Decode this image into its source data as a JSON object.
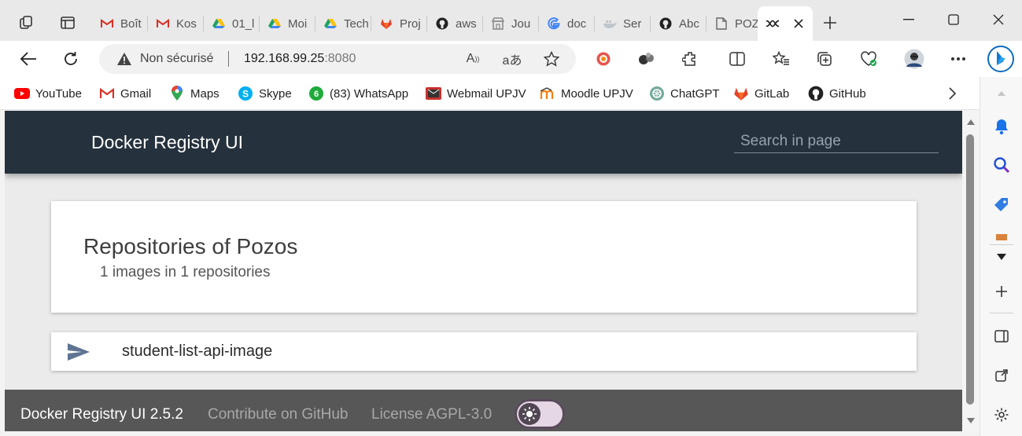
{
  "browser": {
    "tabs": [
      {
        "label": "Boît",
        "icon": "gmail-icon"
      },
      {
        "label": "Kos",
        "icon": "gmail-icon"
      },
      {
        "label": "01_l",
        "icon": "google-drive-icon"
      },
      {
        "label": "Moi",
        "icon": "google-drive-icon"
      },
      {
        "label": "Tech",
        "icon": "google-drive-icon"
      },
      {
        "label": "Proj",
        "icon": "gitlab-icon"
      },
      {
        "label": "aws",
        "icon": "github-icon"
      },
      {
        "label": "Jou",
        "icon": "store-icon"
      },
      {
        "label": "doc",
        "icon": "google-icon"
      },
      {
        "label": "Ser",
        "icon": "docker-icon"
      },
      {
        "label": "Abc",
        "icon": "github-icon"
      },
      {
        "label": "POZ",
        "icon": "page-icon"
      }
    ],
    "active_tab_icon": "docker-registry-icon",
    "address": {
      "security": "Non sécurisé",
      "host": "192.168.99.25",
      "port": ":8080"
    },
    "bookmarks": [
      {
        "label": "YouTube",
        "icon": "youtube-icon"
      },
      {
        "label": "Gmail",
        "icon": "gmail-icon"
      },
      {
        "label": "Maps",
        "icon": "maps-icon"
      },
      {
        "label": "Skype",
        "icon": "skype-icon"
      },
      {
        "label": "(83) WhatsApp",
        "icon": "whatsapp-icon"
      },
      {
        "label": "Webmail UPJV",
        "icon": "webmail-icon"
      },
      {
        "label": "Moodle UPJV",
        "icon": "moodle-icon"
      },
      {
        "label": "ChatGPT",
        "icon": "chatgpt-icon"
      },
      {
        "label": "GitLab",
        "icon": "gitlab-icon"
      },
      {
        "label": "GitHub",
        "icon": "github-icon"
      }
    ],
    "colors": {
      "tabstrip": "#e9e9e9",
      "accent": "#0f6cbd"
    }
  },
  "page": {
    "app_title": "Docker Registry UI",
    "search_placeholder": "Search in page",
    "header_card": {
      "title": "Repositories of Pozos",
      "subtitle": "1 images in 1 repositories"
    },
    "repositories": [
      {
        "name": "student-list-api-image",
        "icon": "send-icon"
      }
    ],
    "footer": {
      "version": "Docker Registry UI 2.5.2",
      "contribute": "Contribute on GitHub",
      "license": "License AGPL-3.0",
      "theme_toggle_icon": "sun-icon"
    },
    "colors": {
      "appbar": "#25323d",
      "footer": "#575757",
      "repo_icon": "#5f7392"
    }
  }
}
